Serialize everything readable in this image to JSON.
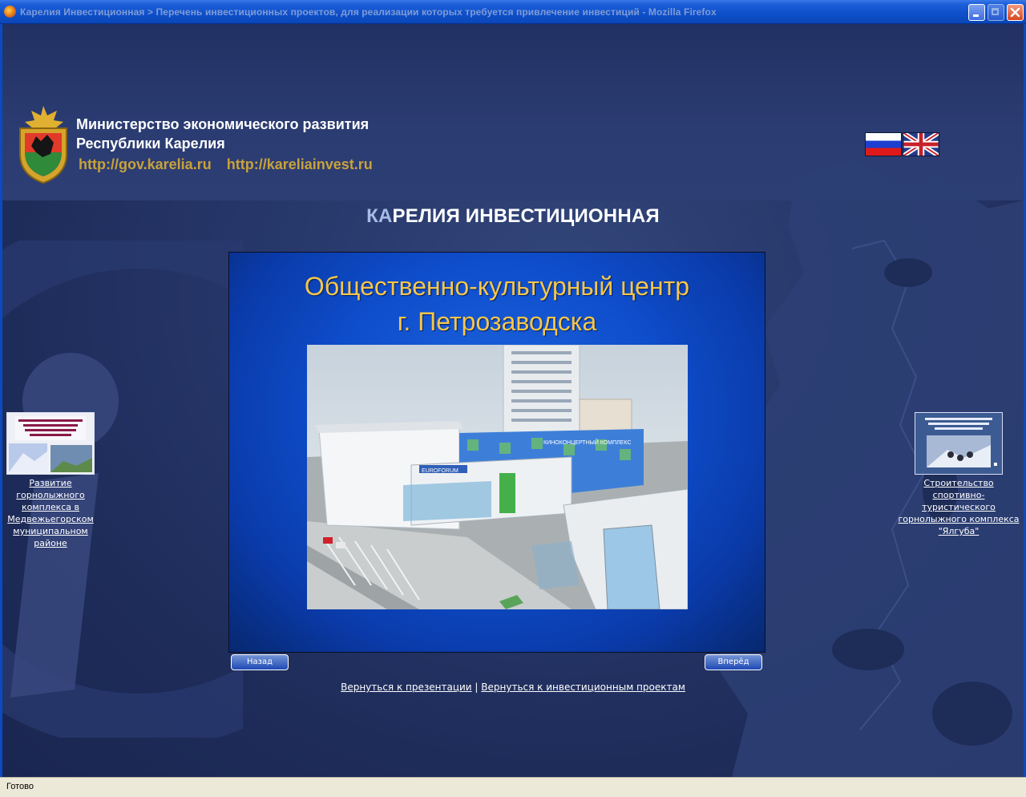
{
  "window": {
    "title": "Карелия Инвестиционная > Перечень инвестиционных проектов, для реализации которых требуется привлечение инвестиций - Mozilla Firefox"
  },
  "header": {
    "ministry_line1": "Министерство экономического развития",
    "ministry_line2": "Республики Карелия",
    "url1": "http://gov.karelia.ru",
    "url2": "http://kareliainvest.ru"
  },
  "languages": [
    {
      "icon": "russian-flag-icon"
    },
    {
      "icon": "uk-flag-icon"
    }
  ],
  "site_title": {
    "highlight": "КА",
    "rest": "РЕЛИЯ ИНВЕСТИЦИОННАЯ"
  },
  "slide": {
    "title_line1": "Общественно-культурный центр",
    "title_line2": "г. Петрозаводска",
    "sign1": "КИНОКОНЦЕРТНЫЙ КОМПЛЕКС",
    "sign2": "EUROFORUM"
  },
  "nav": {
    "back_label": "Назад",
    "forward_label": "Вперёд"
  },
  "footer_links": {
    "presentation": "Вернуться к презентации",
    "separator": "|",
    "projects": "Вернуться к инвестиционным проектам"
  },
  "prev_project": {
    "thumb_title": "Развитие горнолыжного комплекса в Медвежьегорском муниципальном районе",
    "line1": "Развитие",
    "line2": "горнолыжного",
    "line3": "комплекса в",
    "line4": "Медвежьегорском",
    "line5": "муниципальном",
    "line6": "районе"
  },
  "next_project": {
    "thumb_title": "Строительство спортивно-туристского горнолыжного комплекса «Ялгуба»",
    "line1": "Строительство",
    "line2": "спортивно-туристического",
    "line3": "горнолыжного комплекса",
    "line4": "\"Ялгуба\""
  },
  "status": {
    "text": "Готово"
  }
}
